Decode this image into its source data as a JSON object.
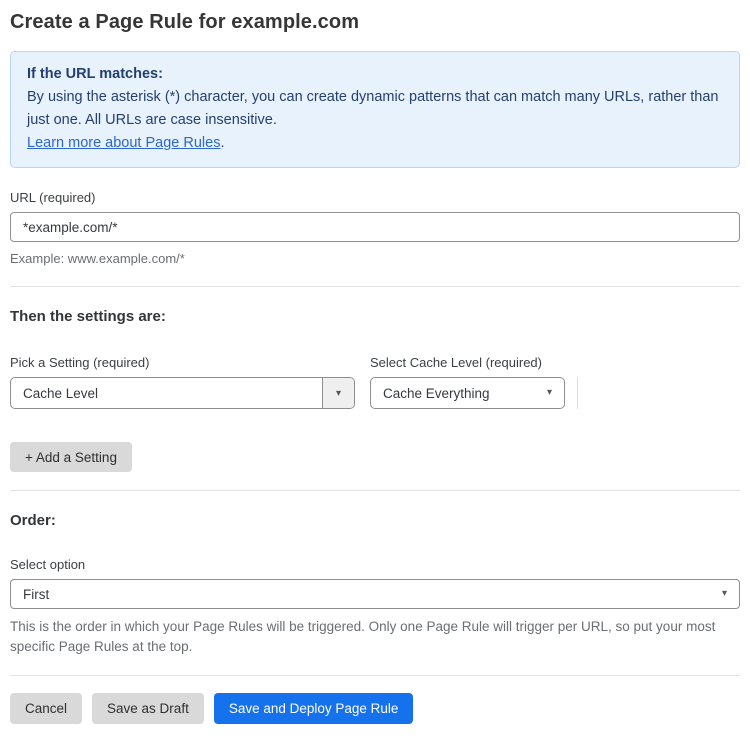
{
  "page": {
    "title": "Create a Page Rule for example.com"
  },
  "info_box": {
    "heading": "If the URL matches:",
    "body": "By using the asterisk (*) character, you can create dynamic patterns that can match many URLs, rather than just one. All URLs are case insensitive.",
    "link_label": "Learn more about Page Rules",
    "link_suffix": "."
  },
  "url_field": {
    "label": "URL (required)",
    "value": "*example.com/*",
    "helper": "Example: www.example.com/*"
  },
  "settings_section": {
    "heading": "Then the settings are:",
    "setting_select": {
      "label": "Pick a Setting (required)",
      "value": "Cache Level"
    },
    "cache_level_select": {
      "label": "Select Cache Level (required)",
      "value": "Cache Everything"
    },
    "add_setting_label": "+ Add a Setting"
  },
  "order_section": {
    "heading": "Order:",
    "label": "Select option",
    "value": "First",
    "helper": "This is the order in which your Page Rules will be triggered. Only one Page Rule will trigger per URL, so put your most specific Page Rules at the top."
  },
  "actions": {
    "cancel_label": "Cancel",
    "save_draft_label": "Save as Draft",
    "save_deploy_label": "Save and Deploy Page Rule"
  },
  "icons": {
    "dropdown_arrow": "▾"
  },
  "colors": {
    "accent_blue": "#1672ec",
    "info_bg": "#e8f2fd",
    "info_border": "#b8d6f1",
    "info_text": "#25406f",
    "link_blue": "#2b67cf",
    "button_gray": "#d9d9d9"
  }
}
